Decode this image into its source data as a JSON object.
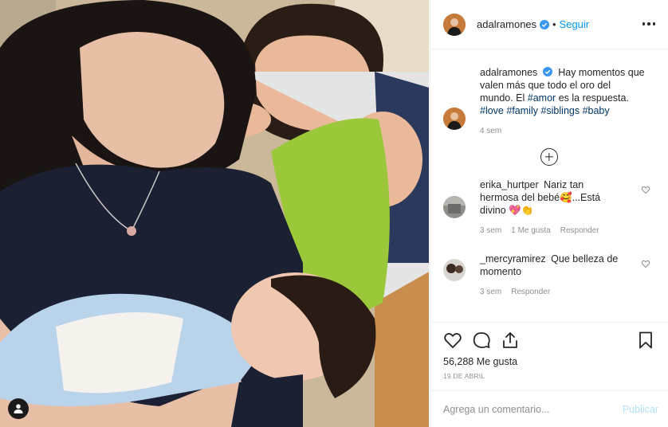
{
  "post": {
    "image_alt": "",
    "username": "adalramones",
    "follow_label": "Seguir",
    "separator": "•"
  },
  "caption": {
    "username": "adalramones",
    "line1": "Hay momentos que",
    "line2": "valen más que todo el oro del",
    "line3_pre": "mundo. El",
    "line3_tag": "#amor",
    "line3_post": "es la respuesta.",
    "tags": [
      "#love",
      "#family",
      "#siblings",
      "#baby"
    ],
    "time": "4 sem"
  },
  "comments": [
    {
      "username": "erika_hurtper",
      "line1": "Nariz tan",
      "line2": "hermosa del bebé🥰...Está",
      "line3": "divino 💖👏",
      "time": "3 sem",
      "likes": "1 Me gusta",
      "reply": "Responder"
    },
    {
      "username": "_mercyramirez",
      "line1": "Que belleza de",
      "line2": "momento",
      "time": "3 sem",
      "reply": "Responder"
    }
  ],
  "stats": {
    "likes": "56,288 Me gusta",
    "date": "19 de abril"
  },
  "add_comment": {
    "placeholder": "Agrega un comentario...",
    "publish": "Publicar"
  },
  "icons": [
    "verified-badge-icon",
    "more-options-icon",
    "load-more-icon",
    "heart-icon",
    "comment-icon",
    "share-icon",
    "bookmark-icon",
    "user-tag-icon"
  ],
  "colors": {
    "link_blue": "#0095f6",
    "hashtag": "#00376b",
    "muted": "#8e8e8e",
    "border": "#efefef",
    "publish_disabled": "#b2dffc"
  }
}
